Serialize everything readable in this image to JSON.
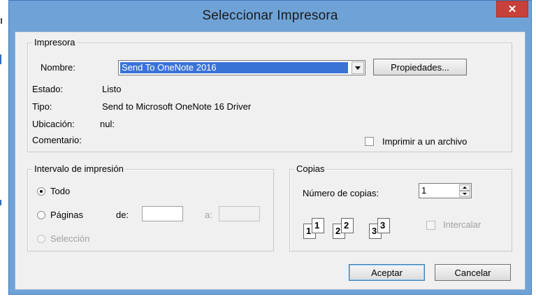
{
  "window": {
    "title": "Seleccionar Impresora",
    "close_glyph": "✕"
  },
  "printer": {
    "group_title": "Impresora",
    "name_label": "Nombre:",
    "name_value": "Send To OneNote 2016",
    "properties_button": "Propiedades...",
    "status_label": "Estado:",
    "status_value": "Listo",
    "type_label": "Tipo:",
    "type_value": "Send to Microsoft OneNote 16 Driver",
    "location_label": "Ubicación:",
    "location_value": "nul:",
    "comment_label": "Comentario:",
    "print_to_file_label": "Imprimir a un archivo",
    "print_to_file_checked": false
  },
  "range": {
    "group_title": "Intervalo de impresión",
    "all_label": "Todo",
    "pages_label": "Páginas",
    "from_label": "de:",
    "to_label": "a:",
    "from_value": "",
    "to_value": "",
    "selection_label": "Selección",
    "selected": "all"
  },
  "copies": {
    "group_title": "Copias",
    "count_label": "Número de copias:",
    "count_value": "1",
    "collate_label": "Intercalar",
    "collate_checked": false,
    "collate_icon_pages": [
      "1",
      "2",
      "3"
    ]
  },
  "buttons": {
    "ok": "Aceptar",
    "cancel": "Cancelar"
  },
  "colors": {
    "titlebar": "#6fa3d8",
    "close": "#c7413a",
    "selection": "#3a73d6",
    "client": "#f0f0f0"
  }
}
